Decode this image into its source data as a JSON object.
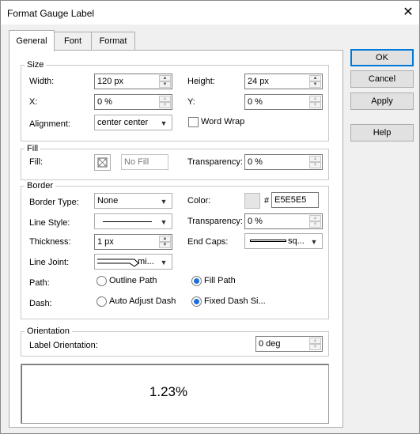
{
  "window": {
    "title": "Format Gauge Label",
    "close_glyph": "✕"
  },
  "tabs": [
    {
      "label": "General",
      "active": true
    },
    {
      "label": "Font"
    },
    {
      "label": "Format"
    }
  ],
  "buttons": {
    "ok": "OK",
    "cancel": "Cancel",
    "apply": "Apply",
    "help": "Help"
  },
  "size": {
    "title": "Size",
    "width_label": "Width:",
    "width_value": "120 px",
    "height_label": "Height:",
    "height_value": "24 px",
    "x_label": "X:",
    "x_value": "0 %",
    "y_label": "Y:",
    "y_value": "0 %",
    "alignment_label": "Alignment:",
    "alignment_value": "center center",
    "word_wrap_label": "Word Wrap",
    "word_wrap_checked": false
  },
  "fill": {
    "title": "Fill",
    "fill_label": "Fill:",
    "fill_value": "No Fill",
    "transparency_label": "Transparency:",
    "transparency_value": "0 %"
  },
  "border": {
    "title": "Border",
    "border_type_label": "Border Type:",
    "border_type_value": "None",
    "color_label": "Color:",
    "color_hash": "#",
    "color_value": "E5E5E5",
    "color_swatch": "#e5e5e5",
    "line_style_label": "Line Style:",
    "transparency_label": "Transparency:",
    "transparency_value": "0 %",
    "thickness_label": "Thickness:",
    "thickness_value": "1 px",
    "end_caps_label": "End Caps:",
    "end_caps_value": "sq...",
    "line_joint_label": "Line Joint:",
    "line_joint_value": "mi...",
    "path_label": "Path:",
    "path_outline": "Outline Path",
    "path_fill": "Fill Path",
    "path_selected": "fill",
    "dash_label": "Dash:",
    "dash_auto": "Auto Adjust Dash",
    "dash_fixed": "Fixed Dash Si...",
    "dash_selected": "fixed"
  },
  "orientation": {
    "title": "Orientation",
    "label_orientation_label": "Label Orientation:",
    "label_orientation_value": "0 deg"
  },
  "preview": {
    "value": "1.23%"
  }
}
